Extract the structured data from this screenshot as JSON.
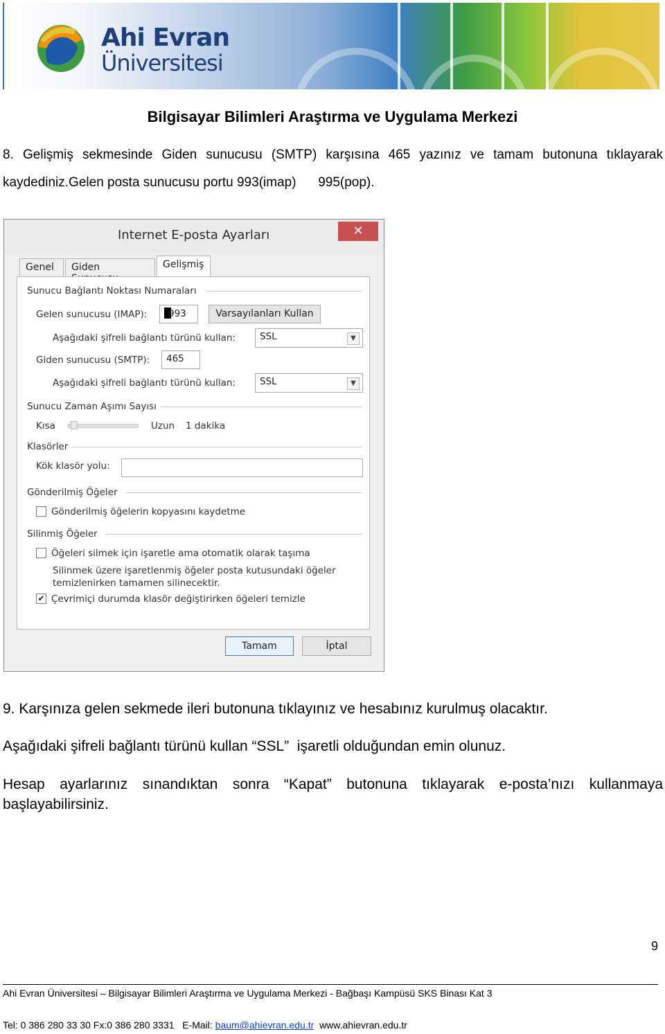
{
  "banner": {
    "logo_line1": "Ahi Evran",
    "logo_line2": "Üniversitesi",
    "logo_icon": "ahi-evran-logo-icon"
  },
  "header_title": "Bilgisayar Bilimleri Araştırma ve Uygulama Merkezi",
  "step8": {
    "line1": "8.  Gelişmiş  sekmesinde  Giden  sunucusu  (SMTP)  karşısına  465  yazınız  ve  tamam  butonuna  tıklayarak",
    "line2": "kaydediniz.Gelen posta sunucusu portu 993(imap)      995(pop)."
  },
  "dialog": {
    "title": "Internet E-posta Ayarları",
    "close_icon": "close-icon",
    "tabs": [
      "Genel",
      "Giden Sunucusu",
      "Gelişmiş"
    ],
    "active_tab": "Gelişmiş",
    "port_group": "Sunucu Bağlantı Noktası Numaraları",
    "incoming_label": "Gelen sunucusu (IMAP):",
    "incoming_value": "993",
    "defaults_button": "Varsayılanları Kullan",
    "enc_label_1": "Aşağıdaki şifreli bağlantı türünü kullan:",
    "enc_value_1": "SSL",
    "outgoing_label": "Giden sunucusu (SMTP):",
    "outgoing_value": "465",
    "enc_label_2": "Aşağıdaki şifreli bağlantı türünü kullan:",
    "enc_value_2": "SSL",
    "timeout_group": "Sunucu Zaman Aşımı Sayısı",
    "timeout_short": "Kısa",
    "timeout_long": "Uzun",
    "timeout_value": "1 dakika",
    "timeout_level": 0.0,
    "folders_group": "Klasörler",
    "root_label": "Kök klasör yolu:",
    "root_value": "",
    "sent_group": "Gönderilmiş Öğeler",
    "sent_check": "Gönderilmiş öğelerin kopyasını kaydetme",
    "sent_checked": false,
    "deleted_group": "Silinmiş Öğeler",
    "deleted_check1": "Öğeleri silmek için işaretle ama otomatik olarak taşıma",
    "deleted_check1_checked": false,
    "deleted_note1": "Silinmek üzere işaretlenmiş öğeler posta kutusundaki öğeler",
    "deleted_note2": "temizlenirken tamamen silinecektir.",
    "deleted_check2": "Çevrimiçi durumda klasör değiştirirken öğeleri temizle",
    "deleted_check2_checked": true,
    "ok_button": "Tamam",
    "cancel_button": "İptal"
  },
  "step9": "9. Karşınıza gelen sekmede ileri butonuna tıklayınız ve hesabınız kurulmuş olacaktır.",
  "ssl_note": "Aşağıdaki şifreli bağlantı türünü kullan “SSL”  işaretli olduğundan emin olunuz.",
  "final_line1": "Hesap  ayarlarınız  sınandıktan  sonra  “Kapat”  butonuna  tıklayarak  e-posta’nızı  kullanmaya",
  "final_line2": "başlayabilirsiniz.",
  "page_number": "9",
  "footer": {
    "address": "Ahi Evran Üniversitesi – Bilgisayar Bilimleri Araştırma ve Uygulama Merkezi - Bağbaşı Kampüsü SKS Binası Kat 3",
    "contact_prefix": "Tel: 0 386 280 33 30 Fx:0 386 280 3331   E-Mail: ",
    "email": "baum@ahievran.edu.tr",
    "website": "www.ahievran.edu.tr"
  }
}
